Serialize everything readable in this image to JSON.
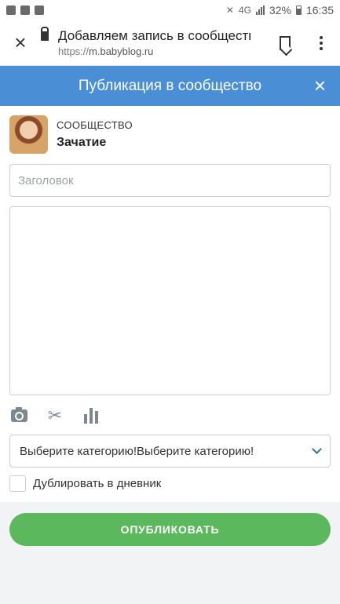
{
  "status_bar": {
    "battery_percent": "32%",
    "time": "16:35",
    "network": "4G",
    "left_icons": [
      "instagram-icon",
      "gallery-icon",
      "facebook-icon"
    ]
  },
  "browser": {
    "close_icon": "×",
    "page_title": "Добавляем запись в сообщество",
    "url_scheme": "https://",
    "url_host": "m.babyblog.ru"
  },
  "modal": {
    "title": "Публикация в сообщество",
    "close_icon": "×",
    "header_color": "#4a8fd6"
  },
  "community": {
    "type_label": "СООБЩЕСТВО",
    "name": "Зачатие"
  },
  "form": {
    "title_placeholder": "Заголовок",
    "title_value": "",
    "body_value": "",
    "tools": [
      "camera-icon",
      "scissors-icon",
      "poll-icon"
    ],
    "category_selected": "Выберите категорию!Выберите категорию!",
    "duplicate_label": "Дублировать в дневник",
    "duplicate_checked": false
  },
  "publish": {
    "label": "ОПУБЛИКОВАТЬ",
    "color": "#5cb85c"
  }
}
